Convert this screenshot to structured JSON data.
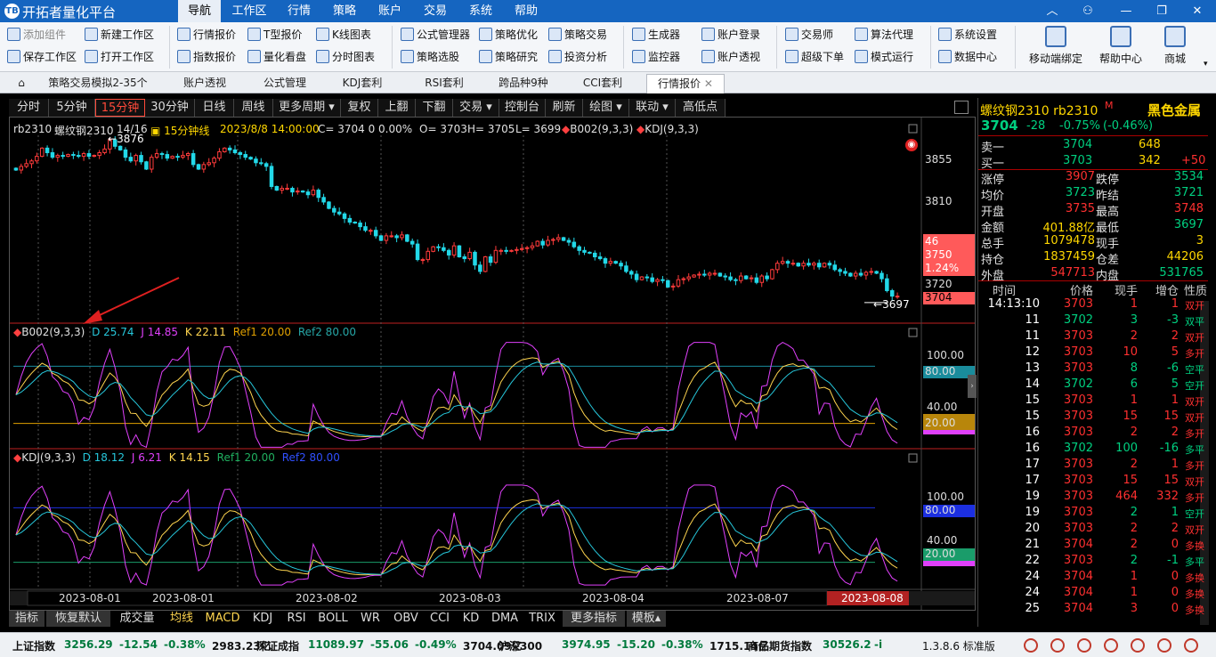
{
  "app": {
    "title": "开拓者量化平台",
    "logo": "TB"
  },
  "menu": [
    "导航",
    "工作区",
    "行情",
    "策略",
    "账户",
    "交易",
    "系统",
    "帮助"
  ],
  "toolbar": {
    "col1": [
      "添加组件",
      "保存工作区"
    ],
    "col2": [
      "新建工作区",
      "打开工作区"
    ],
    "col3": [
      "行情报价",
      "指数报价"
    ],
    "col4": [
      "T型报价",
      "量化看盘"
    ],
    "col5": [
      "K线图表",
      "分时图表"
    ],
    "col6": [
      "公式管理器",
      "策略选股"
    ],
    "col7": [
      "策略优化",
      "策略研究"
    ],
    "col8": [
      "策略交易",
      "投资分析"
    ],
    "col9": [
      "生成器",
      "监控器"
    ],
    "col10": [
      "账户登录",
      "账户透视"
    ],
    "col11": [
      "交易师",
      "超级下单"
    ],
    "col12": [
      "算法代理",
      "模式运行"
    ],
    "col13": [
      "系统设置",
      "数据中心"
    ],
    "big": [
      "移动端绑定",
      "帮助中心",
      "商城"
    ]
  },
  "tabs": [
    "策略交易模拟2-35个",
    "账户透视",
    "公式管理",
    "KDJ套利",
    "RSI套利",
    "跨品种9种",
    "CCI套利",
    "行情报价"
  ],
  "periods": [
    "分时",
    "5分钟",
    "15分钟",
    "30分钟",
    "日线",
    "周线",
    "更多周期 ▾",
    "复权",
    "上翻",
    "下翻",
    "交易 ▾",
    "控制台",
    "刷新",
    "绘图 ▾",
    "联动 ▾",
    "高低点"
  ],
  "main_header": {
    "symbol": "rb2310",
    "name": "螺纹钢2310",
    "count": "14/16",
    "interval": "15分钟线",
    "time": "2023/8/8 14:00:00",
    "c": "C= 3704  0  0.00%",
    "o": "O= 3703",
    "h": "H= 3705",
    "l": "L= 3699",
    "ind1": "B002(9,3,3)",
    "ind2": "KDJ(9,3,3)"
  },
  "price_axis": [
    "3855",
    "3810",
    "3750",
    "3720"
  ],
  "price_box": {
    "vol": "46",
    "price": "3750",
    "pct": "1.24%",
    "last": "3704"
  },
  "hi_label": "3876",
  "lo_label": "3697",
  "sub1": {
    "name": "B002(9,3,3)",
    "d": "D 25.74",
    "j": "J 14.85",
    "k": "K 22.11",
    "ref1": "Ref1 20.00",
    "ref2": "Ref2 80.00",
    "axis": [
      "100.00",
      "80.00",
      "40.00",
      "20.00"
    ]
  },
  "sub2": {
    "name": "KDJ(9,3,3)",
    "d": "D 18.12",
    "j": "J 6.21",
    "k": "K 14.15",
    "ref1": "Ref1 20.00",
    "ref2": "Ref2 80.00",
    "axis": [
      "100.00",
      "80.00",
      "40.00",
      "20.00"
    ]
  },
  "dates": [
    "2023-08-01",
    "2023-08-01",
    "2023-08-02",
    "2023-08-03",
    "2023-08-04",
    "2023-08-07",
    "2023-08-08"
  ],
  "indicators": [
    "指标",
    "恢复默认",
    "成交量",
    "均线",
    "MACD",
    "KDJ",
    "RSI",
    "BOLL",
    "WR",
    "OBV",
    "CCI",
    "KD",
    "DMA",
    "TRIX",
    "更多指标",
    "模板▴"
  ],
  "quote": {
    "title": "螺纹钢2310 rb2310",
    "flag": "M",
    "sector": "黑色金属",
    "last": "3704",
    "chg": "-28",
    "pct": "-0.75%",
    "pct2": "(-0.46%)",
    "ask": {
      "label": "卖一",
      "price": "3704",
      "vol": "648"
    },
    "bid": {
      "label": "买一",
      "price": "3703",
      "vol": "342",
      "chg": "+50"
    },
    "stats": [
      [
        "涨停",
        "3907",
        "跌停",
        "3534"
      ],
      [
        "均价",
        "3723",
        "昨结",
        "3721"
      ],
      [
        "开盘",
        "3735",
        "最高",
        "3748"
      ],
      [
        "金额",
        "401.88亿",
        "最低",
        "3697"
      ],
      [
        "总手",
        "1079478",
        "现手",
        "3"
      ],
      [
        "持仓",
        "1837459",
        "仓差",
        "44206"
      ],
      [
        "外盘",
        "547713",
        "内盘",
        "531765"
      ]
    ],
    "tick_headers": [
      "时间",
      "价格",
      "现手",
      "增仓",
      "性质"
    ],
    "ticks": [
      [
        "14:13:10",
        "3703",
        "1",
        "1",
        "双开"
      ],
      [
        "11",
        "3702",
        "3",
        "-3",
        "双平"
      ],
      [
        "11",
        "3703",
        "2",
        "2",
        "双开"
      ],
      [
        "12",
        "3703",
        "10",
        "5",
        "多开"
      ],
      [
        "13",
        "3703",
        "8",
        "-6",
        "空平"
      ],
      [
        "14",
        "3702",
        "6",
        "5",
        "空开"
      ],
      [
        "15",
        "3703",
        "1",
        "1",
        "双开"
      ],
      [
        "15",
        "3703",
        "15",
        "15",
        "双开"
      ],
      [
        "16",
        "3703",
        "2",
        "2",
        "多开"
      ],
      [
        "16",
        "3702",
        "100",
        "-16",
        "多平"
      ],
      [
        "17",
        "3703",
        "2",
        "1",
        "多开"
      ],
      [
        "17",
        "3703",
        "15",
        "15",
        "双开"
      ],
      [
        "19",
        "3703",
        "464",
        "332",
        "多开"
      ],
      [
        "19",
        "3703",
        "2",
        "1",
        "空开"
      ],
      [
        "20",
        "3703",
        "2",
        "2",
        "双开"
      ],
      [
        "21",
        "3704",
        "2",
        "0",
        "多换"
      ],
      [
        "22",
        "3703",
        "2",
        "-1",
        "多平"
      ],
      [
        "24",
        "3704",
        "1",
        "0",
        "多换"
      ],
      [
        "24",
        "3704",
        "1",
        "0",
        "多换"
      ],
      [
        "25",
        "3704",
        "3",
        "0",
        "多换"
      ]
    ]
  },
  "statusbar": [
    {
      "name": "上证指数",
      "val": "3256.29",
      "chg": "-12.54",
      "pct": "-0.38%",
      "amt": "2983.23亿"
    },
    {
      "name": "深证成指",
      "val": "11089.97",
      "chg": "-55.06",
      "pct": "-0.49%",
      "amt": "3704.09亿"
    },
    {
      "name": "沪深300",
      "val": "3974.95",
      "chg": "-15.20",
      "pct": "-0.38%",
      "amt": "1715.14亿"
    },
    {
      "name": "商品期货指数",
      "val": "30526.2",
      "chg": "-i",
      "pct": "",
      "amt": ""
    }
  ],
  "version": "1.3.8.6 标准版",
  "chart_data": {
    "type": "candlestick",
    "interval": "15分钟",
    "closes": [
      3842,
      3846,
      3849,
      3852,
      3857,
      3866,
      3861,
      3856,
      3858,
      3857,
      3859,
      3858,
      3857,
      3860,
      3857,
      3858,
      3861,
      3865,
      3875,
      3868,
      3864,
      3856,
      3852,
      3858,
      3851,
      3843,
      3856,
      3860,
      3859,
      3855,
      3857,
      3856,
      3858,
      3860,
      3848,
      3843,
      3848,
      3850,
      3855,
      3862,
      3866,
      3864,
      3861,
      3859,
      3856,
      3854,
      3850,
      3849,
      3846,
      3824,
      3820,
      3822,
      3822,
      3818,
      3819,
      3818,
      3815,
      3820,
      3812,
      3807,
      3800,
      3796,
      3794,
      3789,
      3785,
      3784,
      3780,
      3776,
      3776,
      3770,
      3765,
      3770,
      3770,
      3768,
      3771,
      3764,
      3761,
      3744,
      3744,
      3753,
      3758,
      3757,
      3754,
      3749,
      3759,
      3747,
      3745,
      3752,
      3738,
      3731,
      3747,
      3741,
      3754,
      3754,
      3753,
      3754,
      3755,
      3756,
      3757,
      3759,
      3764,
      3760,
      3765,
      3766,
      3768,
      3765,
      3763,
      3758,
      3754,
      3752,
      3751,
      3747,
      3745,
      3740,
      3742,
      3740,
      3737,
      3731,
      3728,
      3722,
      3725,
      3724,
      3720,
      3722,
      3721,
      3714,
      3715,
      3722,
      3723,
      3725,
      3727,
      3728,
      3727,
      3729,
      3729,
      3726,
      3725,
      3722,
      3721,
      3726,
      3723,
      3724,
      3719,
      3726,
      3723,
      3733,
      3740,
      3742,
      3740,
      3740,
      3737,
      3740,
      3738,
      3740,
      3736,
      3740,
      3738,
      3733,
      3731,
      3729,
      3726,
      3729,
      3727,
      3730,
      3731,
      3729,
      3723,
      3710,
      3704,
      3704
    ],
    "hi": 3876,
    "lo": 3697,
    "last": 3704,
    "indicators": {
      "B002": {
        "D": 25.74,
        "J": 14.85,
        "K": 22.11,
        "Ref1": 20,
        "Ref2": 80
      },
      "KDJ": {
        "D": 18.12,
        "J": 6.21,
        "K": 14.15,
        "Ref1": 20,
        "Ref2": 80
      }
    }
  }
}
